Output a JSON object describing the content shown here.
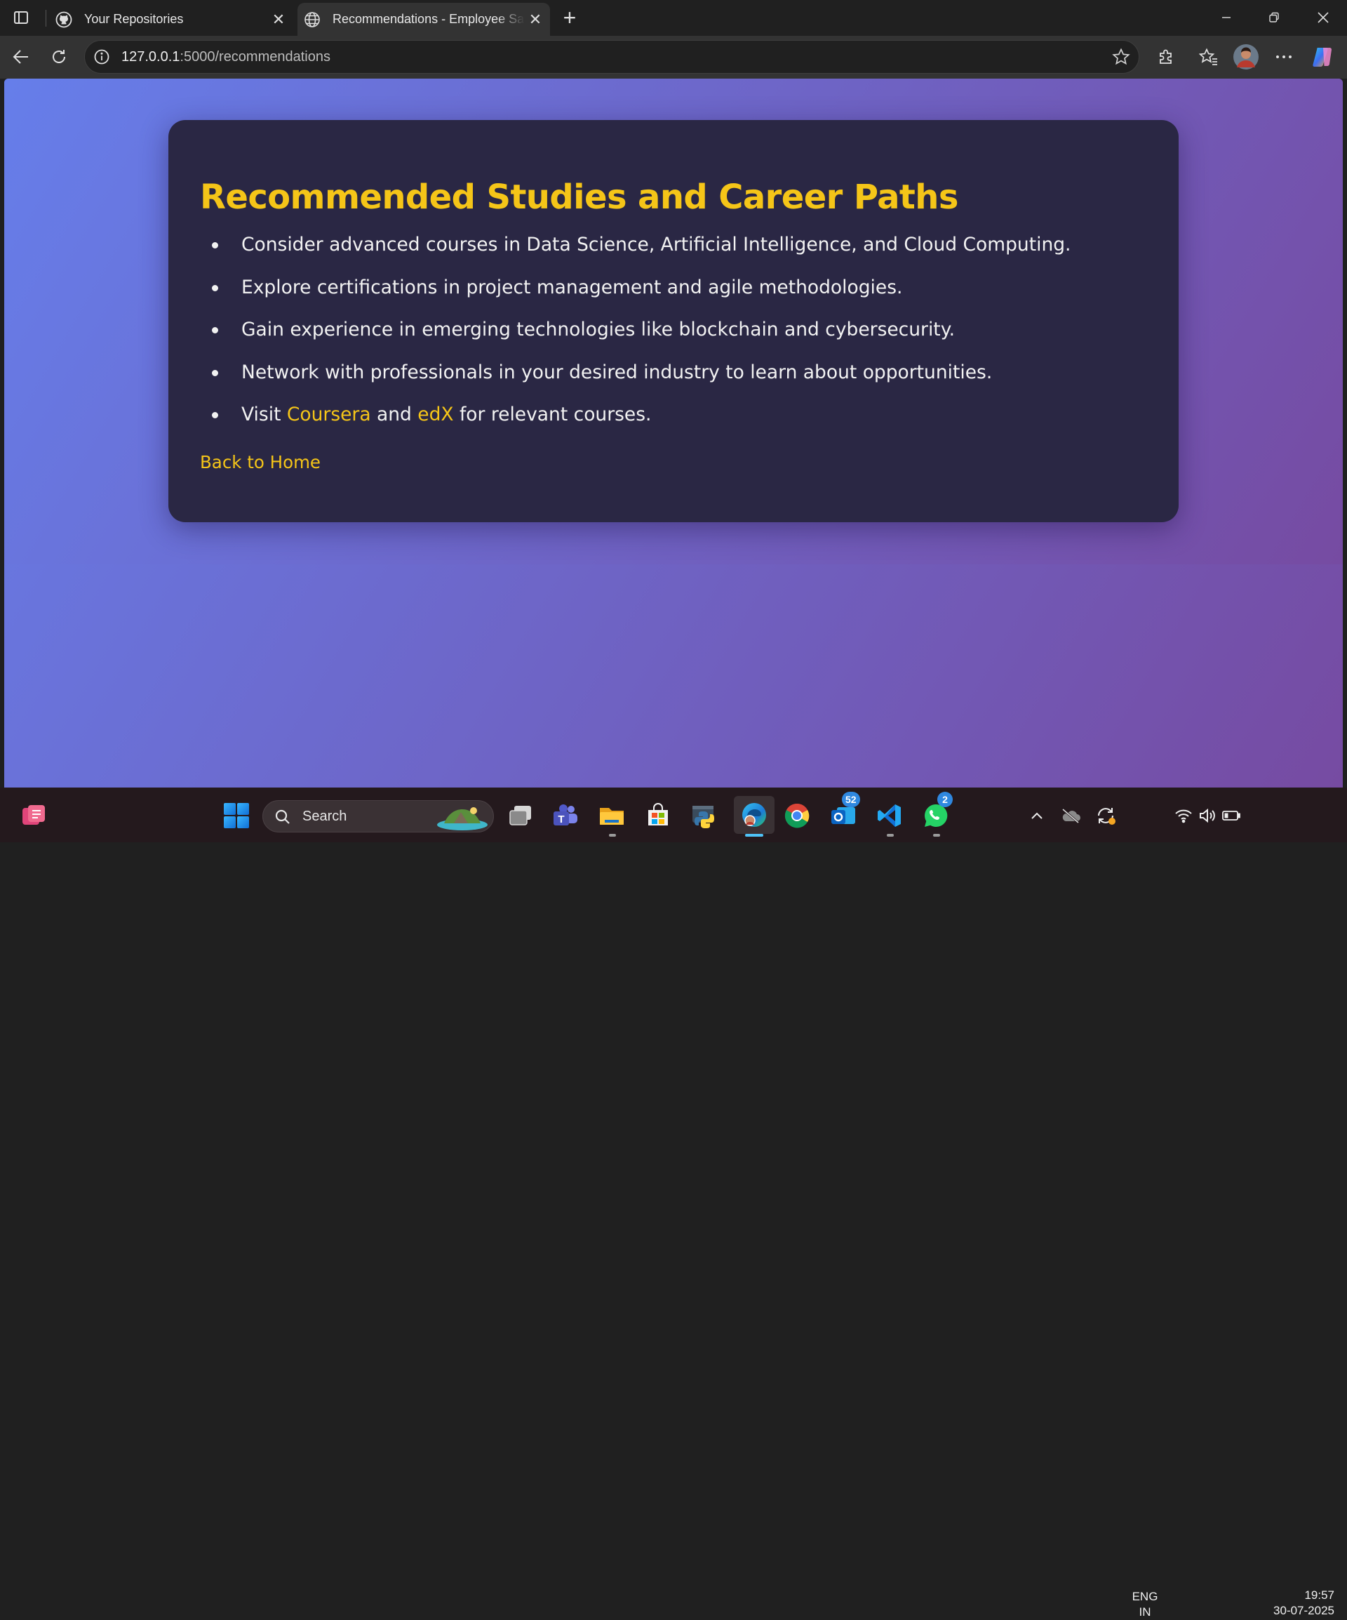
{
  "browser": {
    "tabs": [
      {
        "title": "Your Repositories",
        "favicon": "github-icon",
        "active": false
      },
      {
        "title": "Recommendations - Employee Salary Prediction",
        "favicon": "globe-icon",
        "active": true
      }
    ],
    "address": {
      "host": "127.0.0.1",
      "path": ":5000/recommendations"
    }
  },
  "page": {
    "heading": "Recommended Studies and Career Paths",
    "items": [
      "Consider advanced courses in Data Science, Artificial Intelligence, and Cloud Computing.",
      "Explore certifications in project management and agile methodologies.",
      "Gain experience in emerging technologies like blockchain and cybersecurity.",
      "Network with professionals in your desired industry to learn about opportunities."
    ],
    "last_item": {
      "prefix": "Visit ",
      "link1": "Coursera",
      "middle": " and ",
      "link2": "edX",
      "suffix": " for relevant courses."
    },
    "back_link": "Back to Home",
    "colors": {
      "accent": "#f5c518",
      "card": "#2a2744",
      "gradient_start": "#667eea",
      "gradient_end": "#764ba2"
    }
  },
  "taskbar": {
    "search_label": "Search",
    "badges": {
      "outlook": "52",
      "whatsapp": "2"
    },
    "lang": {
      "line1": "ENG",
      "line2": "IN"
    },
    "clock": {
      "time": "19:57",
      "date": "30-07-2025"
    }
  }
}
